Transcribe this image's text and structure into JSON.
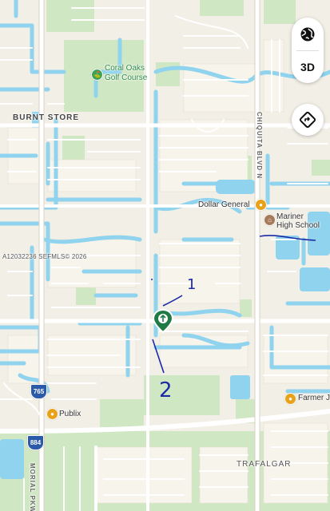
{
  "map": {
    "areas": {
      "burnt_store": "BURNT STORE",
      "trafalgar": "TRAFALGAR"
    },
    "roads": {
      "chiquita": "CHIQUITA BLVD N",
      "memorial": "MORIAL PKWY"
    },
    "pois": {
      "golf": "Coral Oaks\nGolf Course",
      "golf_line1": "Coral Oaks",
      "golf_line2": "Golf Course",
      "dollar_general": "Dollar General",
      "school_line1": "Mariner",
      "school_line2": "High School",
      "publix": "Publix",
      "farmer": "Farmer J"
    },
    "shields": {
      "route_765": "765",
      "route_884": "884"
    },
    "watermark": "A12032236  SEFMLS© 2026",
    "annotations": {
      "num1": "1",
      "num2": "2"
    },
    "colors": {
      "land": "#f2efe6",
      "water": "#8fd3ee",
      "park": "#cfe7c2",
      "road": "#ffffff",
      "annotation": "#1c2aa8",
      "pin": "#1f7a44"
    }
  },
  "controls": {
    "globe_icon": "globe-icon",
    "mode_3d": "3D",
    "directions_icon": "directions-icon"
  }
}
